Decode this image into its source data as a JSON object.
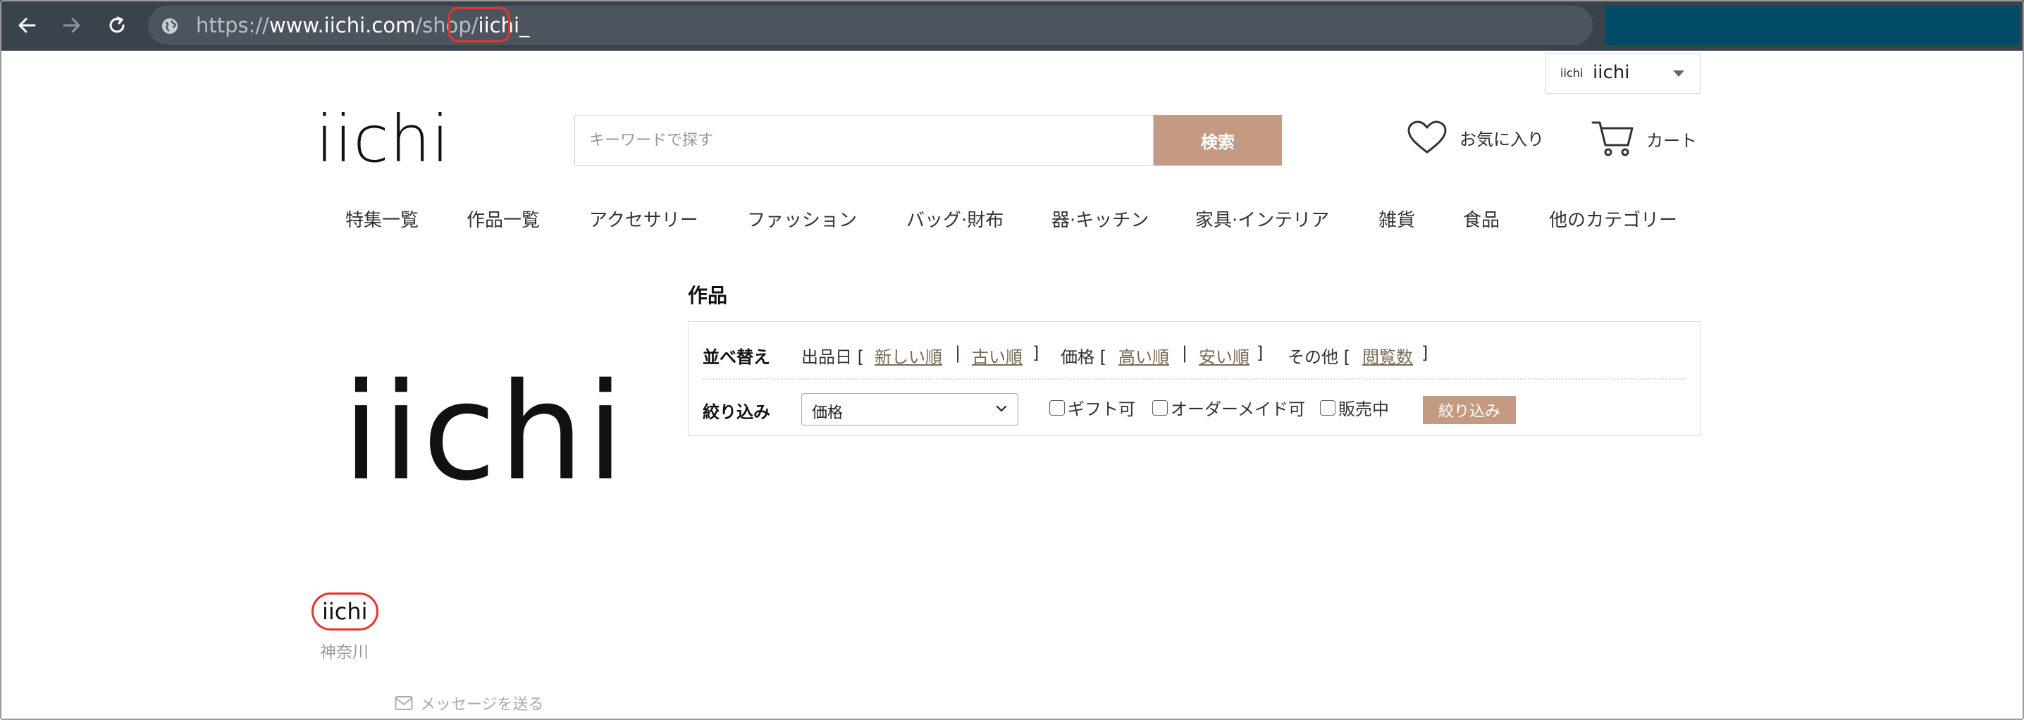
{
  "browser": {
    "url_prefix": "https://",
    "url_host": "www.iichi.com",
    "url_path": "/shop/",
    "url_highlight": "iichi_"
  },
  "account": {
    "mini_label": "iichi",
    "name": "iichi"
  },
  "header": {
    "logo": "iichi",
    "search_placeholder": "キーワードで探す",
    "search_button": "検索",
    "favorites": "お気に入り",
    "cart": "カート"
  },
  "categories": [
    "特集一覧",
    "作品一覧",
    "アクセサリー",
    "ファッション",
    "バッグ·財布",
    "器·キッチン",
    "家具·インテリア",
    "雑貨",
    "食品",
    "他のカテゴリー"
  ],
  "shop": {
    "logo_text": "iichi",
    "name": "iichi",
    "prefecture": "神奈川",
    "message_link": "メッセージを送る"
  },
  "products": {
    "title": "作品",
    "sort": {
      "label": "並べ替え",
      "date_label": "出品日 [",
      "newest": "新しい順",
      "sep": "|",
      "oldest": "古い順",
      "close": "]",
      "price_label": "価格 [",
      "price_high": "高い順",
      "price_low": "安い順",
      "other_label": "その他 [",
      "views": "閲覧数"
    },
    "filter": {
      "label": "絞り込み",
      "select_value": "価格",
      "gift": "ギフト可",
      "order_made": "オーダーメイド可",
      "on_sale": "販売中",
      "button": "絞り込み"
    }
  },
  "colors": {
    "accent": "#c49a82",
    "highlight": "#e5352b",
    "toolbar": "#3a434c",
    "link": "#7a6a55"
  }
}
